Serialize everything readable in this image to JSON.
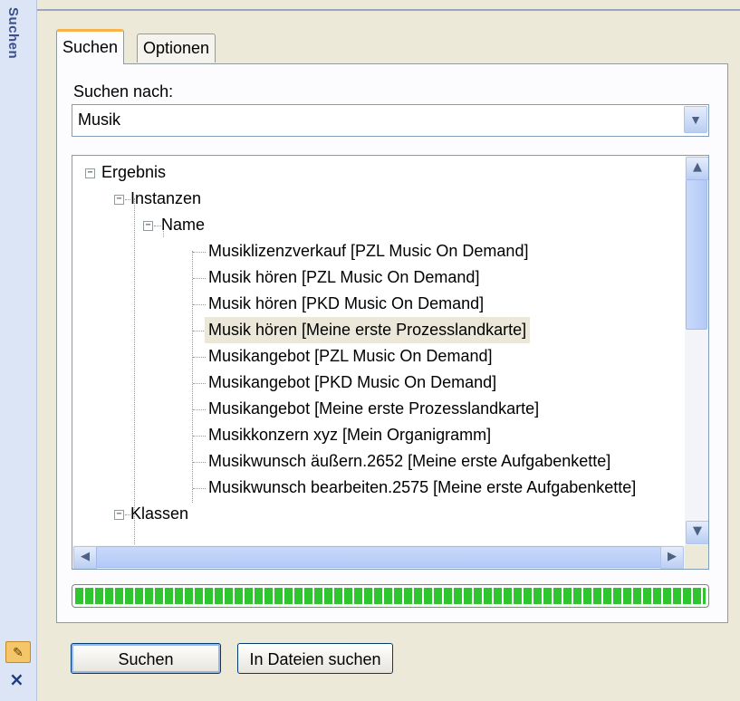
{
  "sidebar": {
    "title": "Suchen",
    "pin_icon": "pin-icon",
    "close_icon": "close-icon",
    "close_glyph": "×"
  },
  "tabs": [
    {
      "label": "Suchen",
      "active": true
    },
    {
      "label": "Optionen",
      "active": false
    }
  ],
  "search": {
    "label": "Suchen nach:",
    "value": "Musik"
  },
  "tree": {
    "root": "Ergebnis",
    "instanzen": "Instanzen",
    "name": "Name",
    "items": [
      "Musiklizenzverkauf [PZL Music On Demand]",
      "Musik hören [PZL Music On Demand]",
      "Musik hören [PKD Music On Demand]",
      "Musik hören [Meine erste Prozesslandkarte]",
      "Musikangebot [PZL Music On Demand]",
      "Musikangebot [PKD Music On Demand]",
      "Musikangebot [Meine erste Prozesslandkarte]",
      "Musikkonzern xyz [Mein Organigramm]",
      "Musikwunsch äußern.2652 [Meine erste Aufgabenkette]",
      "Musikwunsch bearbeiten.2575 [Meine erste Aufgabenkette]"
    ],
    "selected_index": 3,
    "klassen": "Klassen"
  },
  "progress": {
    "value": 1.0,
    "color": "#2fc52f"
  },
  "buttons": {
    "search": "Suchen",
    "search_files": "In Dateien suchen"
  }
}
